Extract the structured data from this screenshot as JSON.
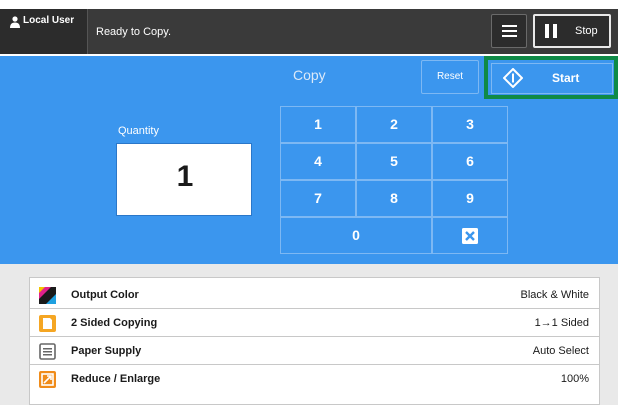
{
  "header": {
    "user_label": "Local User",
    "status": "Ready to Copy.",
    "stop_label": "Stop",
    "icons": {
      "user": "user-icon",
      "menu": "menu-icon",
      "stop": "pause-icon"
    }
  },
  "copy_panel": {
    "title": "Copy",
    "reset_label": "Reset",
    "start_label": "Start",
    "start_icon": "diamond-start-icon",
    "quantity_label": "Quantity",
    "quantity_value": "1",
    "keypad": [
      "1",
      "2",
      "3",
      "4",
      "5",
      "6",
      "7",
      "8",
      "9",
      "0"
    ],
    "clear_icon": "clear-x-icon",
    "colors": {
      "panel": "#3b96ee",
      "start_highlight": "#0f8a47"
    }
  },
  "features": [
    {
      "label": "Output Color",
      "value": "Black & White",
      "icon": "color-icon"
    },
    {
      "label": "2 Sided Copying",
      "value": "1→1 Sided",
      "icon": "duplex-icon"
    },
    {
      "label": "Paper Supply",
      "value": "Auto Select",
      "icon": "paper-tray-icon"
    },
    {
      "label": "Reduce / Enlarge",
      "value": "100%",
      "icon": "reduce-enlarge-icon"
    }
  ]
}
